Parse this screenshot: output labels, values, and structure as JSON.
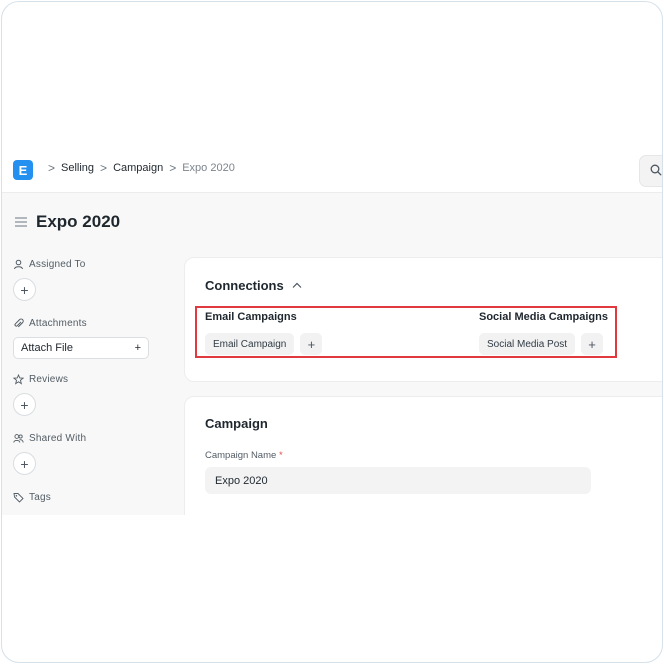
{
  "navbar": {
    "logo_letter": "E",
    "breadcrumbs": [
      "Selling",
      "Campaign",
      "Expo 2020"
    ],
    "separator": ">"
  },
  "page": {
    "title": "Expo 2020"
  },
  "sidebar": {
    "assigned_to": "Assigned To",
    "attachments": "Attachments",
    "attach_file": "Attach File",
    "reviews": "Reviews",
    "shared_with": "Shared With",
    "tags": "Tags",
    "add_symbol": "+"
  },
  "connections": {
    "title": "Connections",
    "groups": [
      {
        "title": "Email Campaigns",
        "item": "Email Campaign"
      },
      {
        "title": "Social Media Campaigns",
        "item": "Social Media Post"
      }
    ]
  },
  "campaign": {
    "title": "Campaign",
    "field_label": "Campaign Name",
    "required_mark": "*",
    "field_value": "Expo 2020"
  },
  "colors": {
    "accent": "#2490ef",
    "highlight": "#e0393e",
    "app_bg": "#f8f8f8"
  }
}
